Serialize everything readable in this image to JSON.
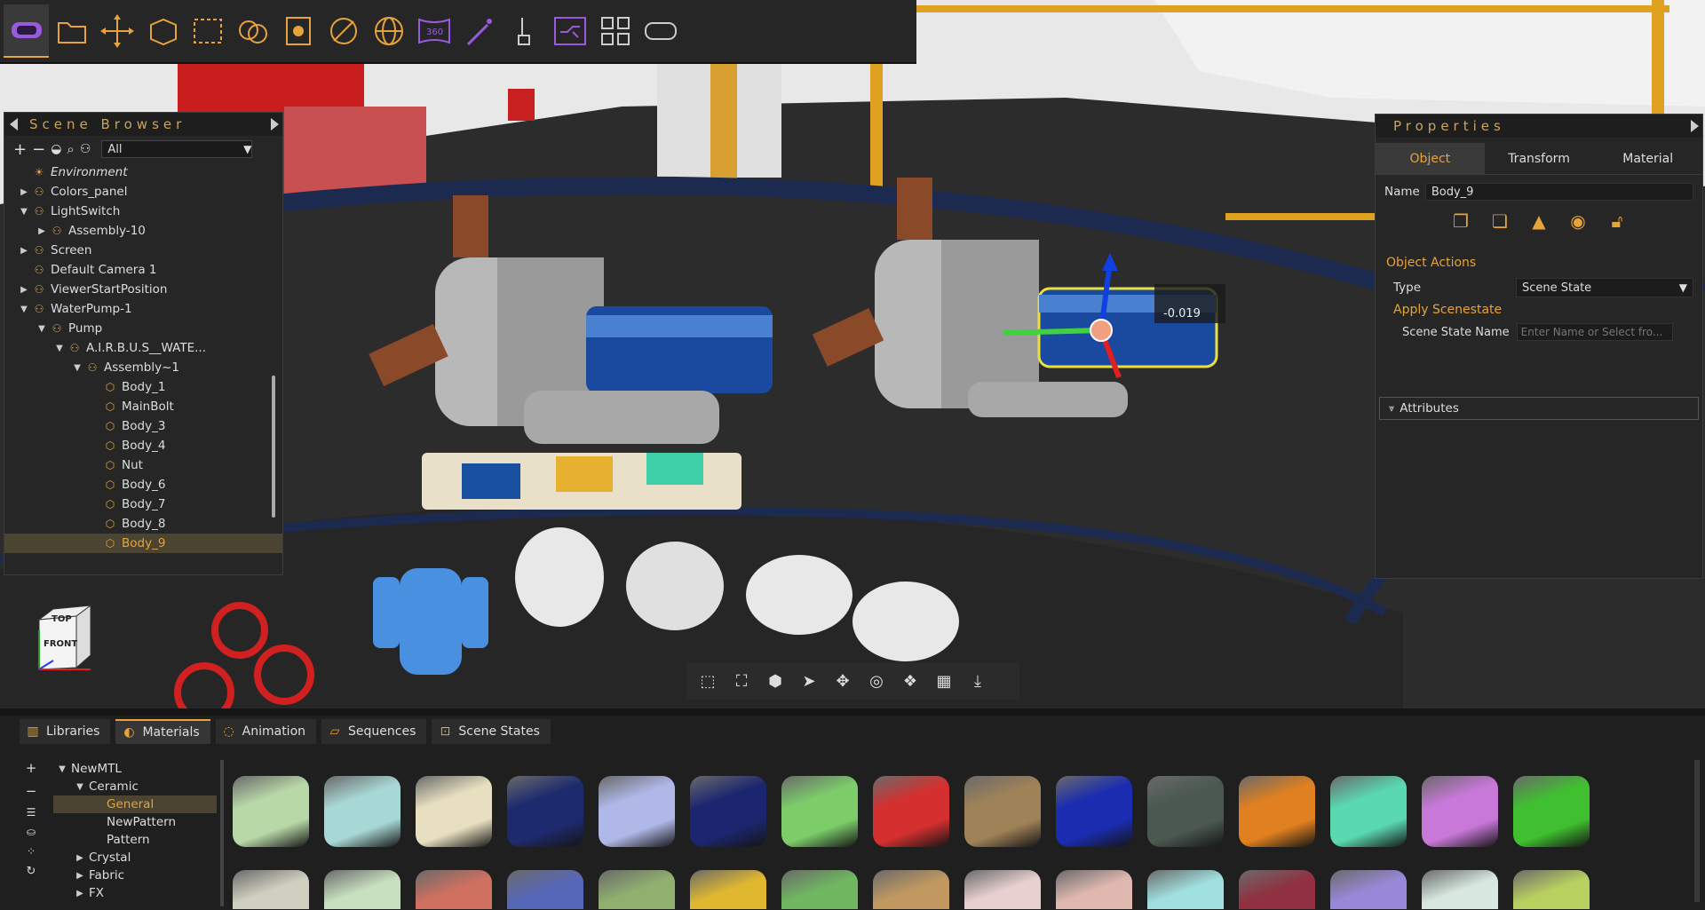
{
  "toolbar": {
    "icons": [
      "vr-headset-icon",
      "folder-icon",
      "move-icon",
      "box-edit-icon",
      "select-rect-icon",
      "spheres-icon",
      "screen-capture-icon",
      "hide-icon",
      "globe-icon",
      "panorama-360-icon",
      "magic-wand-icon",
      "touch-icon",
      "workflow-icon",
      "layout-icon",
      "vr-goggles-icon"
    ],
    "badge_360": "360"
  },
  "scene_browser": {
    "title": "Scene Browser",
    "filter": "All",
    "tree": [
      {
        "label": "Environment",
        "depth": 0,
        "twisty": "",
        "type": "env"
      },
      {
        "label": "Colors_panel",
        "depth": 0,
        "twisty": "▶",
        "type": "group"
      },
      {
        "label": "LightSwitch",
        "depth": 0,
        "twisty": "▼",
        "type": "group"
      },
      {
        "label": "Assembly-10",
        "depth": 1,
        "twisty": "▶",
        "type": "group"
      },
      {
        "label": "Screen",
        "depth": 0,
        "twisty": "▶",
        "type": "group"
      },
      {
        "label": "Default Camera 1",
        "depth": 0,
        "twisty": "",
        "type": "group"
      },
      {
        "label": "ViewerStartPosition",
        "depth": 0,
        "twisty": "▶",
        "type": "group"
      },
      {
        "label": "WaterPump-1",
        "depth": 0,
        "twisty": "▼",
        "type": "group"
      },
      {
        "label": "Pump",
        "depth": 1,
        "twisty": "▼",
        "type": "group"
      },
      {
        "label": "A.I.R.B.U.S__WATE...",
        "depth": 2,
        "twisty": "▼",
        "type": "group"
      },
      {
        "label": "Assembly~1",
        "depth": 3,
        "twisty": "▼",
        "type": "group"
      },
      {
        "label": "Body_1",
        "depth": 4,
        "twisty": "",
        "type": "mesh"
      },
      {
        "label": "MainBolt",
        "depth": 4,
        "twisty": "",
        "type": "mesh"
      },
      {
        "label": "Body_3",
        "depth": 4,
        "twisty": "",
        "type": "mesh"
      },
      {
        "label": "Body_4",
        "depth": 4,
        "twisty": "",
        "type": "mesh"
      },
      {
        "label": "Nut",
        "depth": 4,
        "twisty": "",
        "type": "mesh"
      },
      {
        "label": "Body_6",
        "depth": 4,
        "twisty": "",
        "type": "mesh"
      },
      {
        "label": "Body_7",
        "depth": 4,
        "twisty": "",
        "type": "mesh"
      },
      {
        "label": "Body_8",
        "depth": 4,
        "twisty": "",
        "type": "mesh"
      },
      {
        "label": "Body_9",
        "depth": 4,
        "twisty": "",
        "type": "mesh",
        "selected": true
      }
    ]
  },
  "viewport": {
    "gizmo_value": "-0.019",
    "cube_top": "TOP",
    "cube_front": "FRONT"
  },
  "properties": {
    "title": "Properties",
    "tabs": [
      "Object",
      "Transform",
      "Material"
    ],
    "active_tab": "Object",
    "name_label": "Name",
    "name_value": "Body_9",
    "object_actions": "Object Actions",
    "type_label": "Type",
    "type_value": "Scene State",
    "apply_scenestate": "Apply Scenestate",
    "scene_state_name_label": "Scene State Name",
    "scene_state_name_placeholder": "Enter Name or Select fro...",
    "attributes": "Attributes"
  },
  "bottom_tabs": [
    {
      "label": "Libraries",
      "icon": "libraries-icon"
    },
    {
      "label": "Materials",
      "icon": "materials-icon",
      "active": true
    },
    {
      "label": "Animation",
      "icon": "animation-icon"
    },
    {
      "label": "Sequences",
      "icon": "sequences-icon"
    },
    {
      "label": "Scene States",
      "icon": "scene-states-icon"
    }
  ],
  "materials_tree": [
    {
      "label": "NewMTL",
      "depth": 0,
      "twisty": "▼"
    },
    {
      "label": "Ceramic",
      "depth": 1,
      "twisty": "▼"
    },
    {
      "label": "General",
      "depth": 2,
      "twisty": "",
      "selected": true
    },
    {
      "label": "NewPattern",
      "depth": 2,
      "twisty": ""
    },
    {
      "label": "Pattern",
      "depth": 2,
      "twisty": ""
    },
    {
      "label": "Crystal",
      "depth": 1,
      "twisty": "▶"
    },
    {
      "label": "Fabric",
      "depth": 1,
      "twisty": "▶"
    },
    {
      "label": "FX",
      "depth": 1,
      "twisty": "▶"
    }
  ],
  "swatches_row1": [
    "#b8d8a8",
    "#a8d8d6",
    "#e8dfc0",
    "#1e2a6e",
    "#b0b8e8",
    "#1c2670",
    "#7ccc6a",
    "#d43030",
    "#a08258",
    "#1a2cb0",
    "#4a5850",
    "#e08020",
    "#5ad8b0",
    "#c878d8",
    "#40c030"
  ],
  "swatches_row2": [
    "#d0d0c0",
    "#c8e0c0",
    "#d07060",
    "#5868b8",
    "#90b070",
    "#e0b830",
    "#70b860",
    "#c09860",
    "#e8d0d0",
    "#e0b8b0",
    "#a0e0e0",
    "#903040",
    "#9888d8",
    "#d8e8e0",
    "#b8d060"
  ]
}
